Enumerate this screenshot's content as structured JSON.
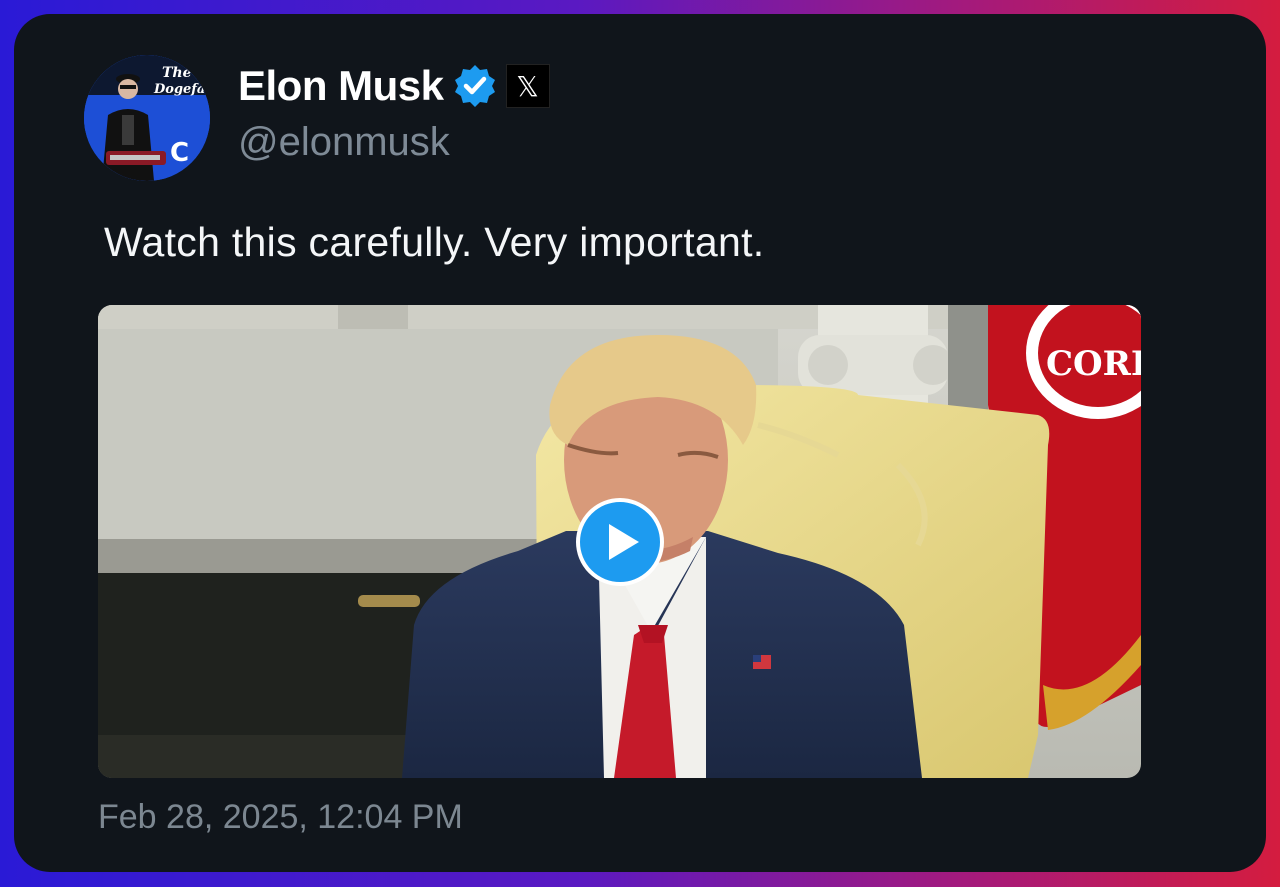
{
  "author": {
    "display_name": "Elon Musk",
    "handle": "@elonmusk",
    "verified_icon": "verified-badge-icon",
    "affiliate_icon": "x-logo-icon",
    "affiliate_glyph": "𝕏",
    "avatar_overlay_text": "The Dogefa"
  },
  "tweet": {
    "text": "Watch this carefully. Very important.",
    "media_type": "video",
    "play_icon": "play-icon",
    "timestamp": "Feb 28, 2025, 12:04 PM"
  },
  "colors": {
    "card_background": "#10151b",
    "accent": "#1d9bf0",
    "muted_text": "#7e8a96"
  }
}
